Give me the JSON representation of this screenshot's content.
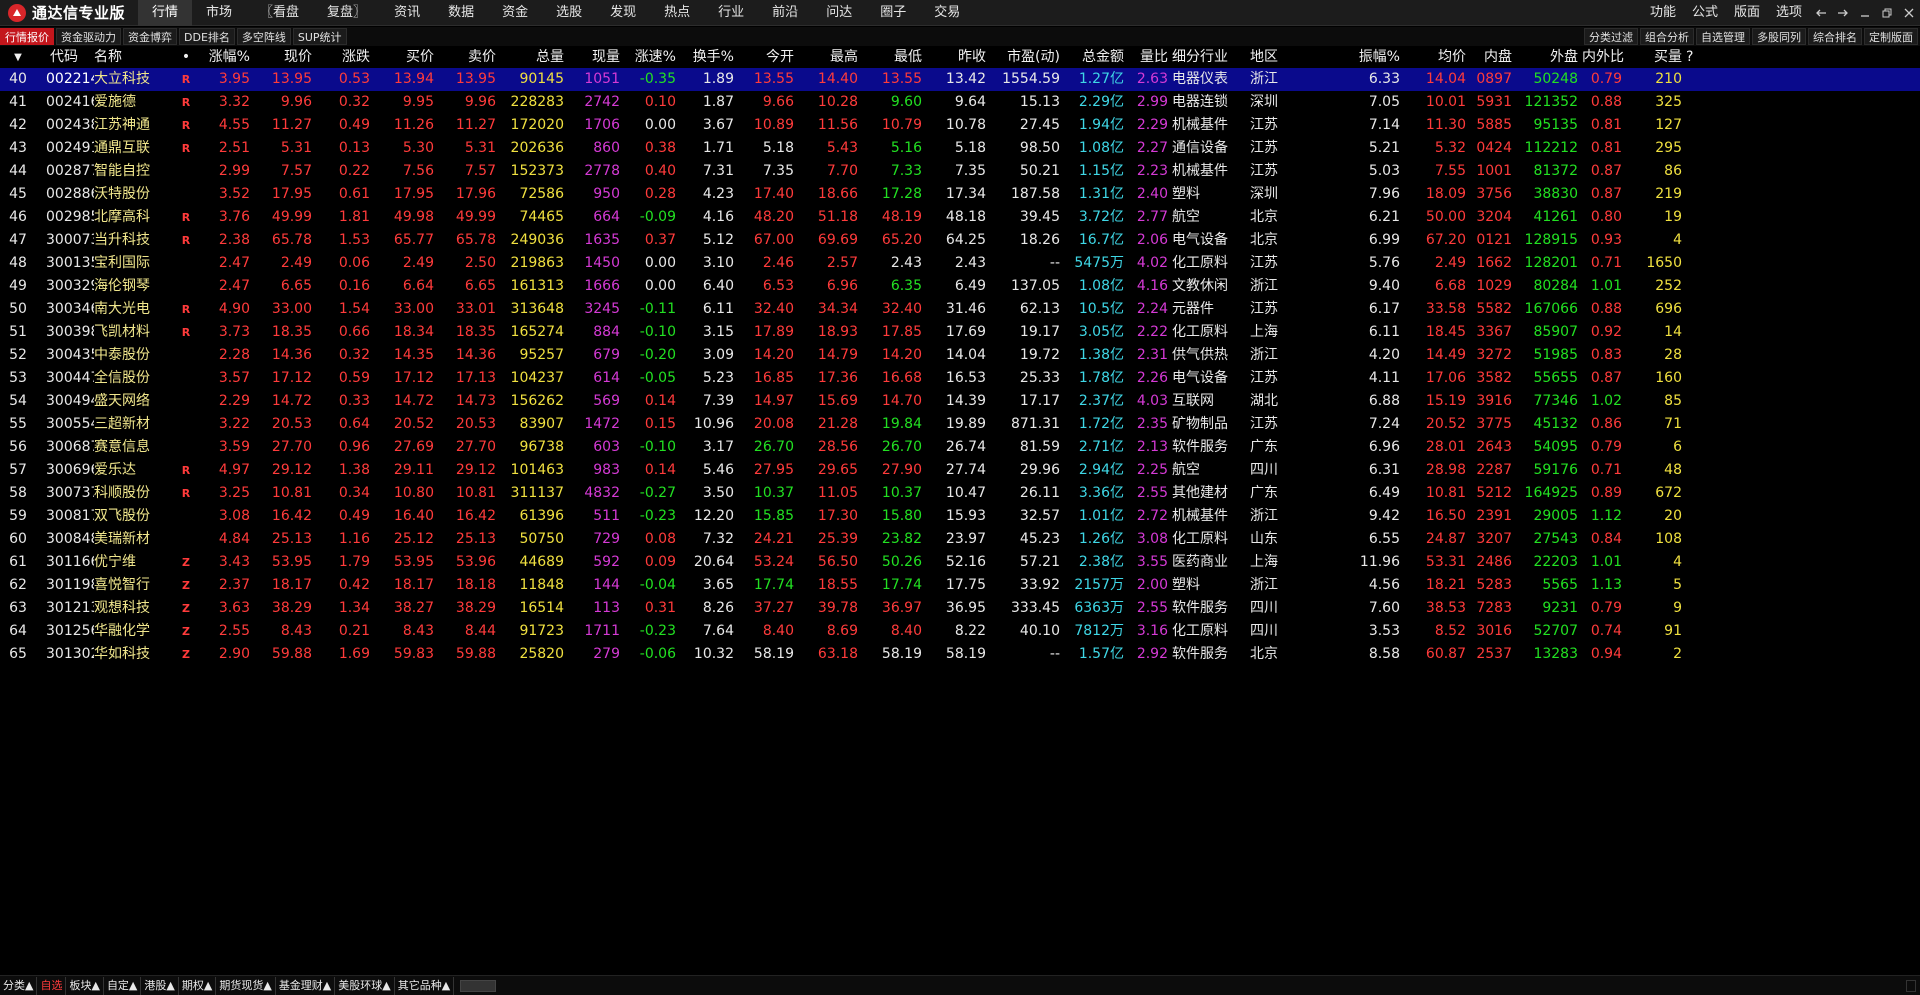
{
  "app": {
    "title": "通达信专业版"
  },
  "top_menu": [
    "行情",
    "市场",
    "〖看盘",
    "复盘〗",
    "资讯",
    "数据",
    "资金",
    "选股",
    "发现",
    "热点",
    "行业",
    "前沿",
    "问达",
    "圈子",
    "交易"
  ],
  "top_right_menu": [
    "功能",
    "公式",
    "版面",
    "选项"
  ],
  "sub_tabs": [
    "行情报价",
    "资金驱动力",
    "资金博弈",
    "DDE排名",
    "多空阵线",
    "SUP统计"
  ],
  "sub_tabs_right": [
    "分类过滤",
    "组合分析",
    "自选管理",
    "多股同列",
    "综合排名",
    "定制版面"
  ],
  "columns": [
    "代码",
    "名称",
    "•",
    "涨幅%",
    "现价",
    "涨跌",
    "买价",
    "卖价",
    "总量",
    "现量",
    "涨速%",
    "换手%",
    "今开",
    "最高",
    "最低",
    "昨收",
    "市盈(动)",
    "总金额",
    "量比",
    "细分行业",
    "地区",
    "振幅%",
    "均价",
    "内盘",
    "外盘",
    "内外比",
    "买量",
    "?"
  ],
  "rows": [
    [
      "40",
      "002214",
      "大立科技",
      "R",
      "3.95",
      "13.95",
      "0.53",
      "13.94",
      "13.95",
      "90145",
      "1051",
      "-0.35",
      "1.89",
      "13.55",
      "14.40",
      "13.55",
      "13.42",
      "1554.59",
      "1.27亿",
      "2.63",
      "电器仪表",
      "浙江",
      "6.33",
      "14.04",
      "0897",
      "50248",
      "0.79",
      "210"
    ],
    [
      "41",
      "002416",
      "爱施德",
      "R",
      "3.32",
      "9.96",
      "0.32",
      "9.95",
      "9.96",
      "228283",
      "2742",
      "0.10",
      "1.87",
      "9.66",
      "10.28",
      "9.60",
      "9.64",
      "15.13",
      "2.29亿",
      "2.99",
      "电器连锁",
      "深圳",
      "7.05",
      "10.01",
      "5931",
      "121352",
      "0.88",
      "325"
    ],
    [
      "42",
      "002438",
      "江苏神通",
      "R",
      "4.55",
      "11.27",
      "0.49",
      "11.26",
      "11.27",
      "172020",
      "1706",
      "0.00",
      "3.67",
      "10.89",
      "11.56",
      "10.79",
      "10.78",
      "27.45",
      "1.94亿",
      "2.29",
      "机械基件",
      "江苏",
      "7.14",
      "11.30",
      "5885",
      "95135",
      "0.81",
      "127"
    ],
    [
      "43",
      "002491",
      "通鼎互联",
      "R",
      "2.51",
      "5.31",
      "0.13",
      "5.30",
      "5.31",
      "202636",
      "860",
      "0.38",
      "1.71",
      "5.18",
      "5.43",
      "5.16",
      "5.18",
      "98.50",
      "1.08亿",
      "2.27",
      "通信设备",
      "江苏",
      "5.21",
      "5.32",
      "0424",
      "112212",
      "0.81",
      "295"
    ],
    [
      "44",
      "002877",
      "智能自控",
      "",
      "2.99",
      "7.57",
      "0.22",
      "7.56",
      "7.57",
      "152373",
      "2778",
      "0.40",
      "7.31",
      "7.35",
      "7.70",
      "7.33",
      "7.35",
      "50.21",
      "1.15亿",
      "2.23",
      "机械基件",
      "江苏",
      "5.03",
      "7.55",
      "1001",
      "81372",
      "0.87",
      "86"
    ],
    [
      "45",
      "002886",
      "沃特股份",
      "",
      "3.52",
      "17.95",
      "0.61",
      "17.95",
      "17.96",
      "72586",
      "950",
      "0.28",
      "4.23",
      "17.40",
      "18.66",
      "17.28",
      "17.34",
      "187.58",
      "1.31亿",
      "2.40",
      "塑料",
      "深圳",
      "7.96",
      "18.09",
      "3756",
      "38830",
      "0.87",
      "219"
    ],
    [
      "46",
      "002985",
      "北摩高科",
      "R",
      "3.76",
      "49.99",
      "1.81",
      "49.98",
      "49.99",
      "74465",
      "664",
      "-0.09",
      "4.16",
      "48.20",
      "51.18",
      "48.19",
      "48.18",
      "39.45",
      "3.72亿",
      "2.77",
      "航空",
      "北京",
      "6.21",
      "50.00",
      "3204",
      "41261",
      "0.80",
      "19"
    ],
    [
      "47",
      "300073",
      "当升科技",
      "R",
      "2.38",
      "65.78",
      "1.53",
      "65.77",
      "65.78",
      "249036",
      "1635",
      "0.37",
      "5.12",
      "67.00",
      "69.69",
      "65.20",
      "64.25",
      "18.26",
      "16.7亿",
      "2.06",
      "电气设备",
      "北京",
      "6.99",
      "67.20",
      "0121",
      "128915",
      "0.93",
      "4"
    ],
    [
      "48",
      "300135",
      "宝利国际",
      "",
      "2.47",
      "2.49",
      "0.06",
      "2.49",
      "2.50",
      "219863",
      "1450",
      "0.00",
      "3.10",
      "2.46",
      "2.57",
      "2.43",
      "2.43",
      "--",
      "5475万",
      "4.02",
      "化工原料",
      "江苏",
      "5.76",
      "2.49",
      "1662",
      "128201",
      "0.71",
      "1650"
    ],
    [
      "49",
      "300329",
      "海伦钢琴",
      "",
      "2.47",
      "6.65",
      "0.16",
      "6.64",
      "6.65",
      "161313",
      "1666",
      "0.00",
      "6.40",
      "6.53",
      "6.96",
      "6.35",
      "6.49",
      "137.05",
      "1.08亿",
      "4.16",
      "文教休闲",
      "浙江",
      "9.40",
      "6.68",
      "1029",
      "80284",
      "1.01",
      "252"
    ],
    [
      "50",
      "300346",
      "南大光电",
      "R",
      "4.90",
      "33.00",
      "1.54",
      "33.00",
      "33.01",
      "313648",
      "3245",
      "-0.11",
      "6.11",
      "32.40",
      "34.34",
      "32.40",
      "31.46",
      "62.13",
      "10.5亿",
      "2.24",
      "元器件",
      "江苏",
      "6.17",
      "33.58",
      "5582",
      "167066",
      "0.88",
      "696"
    ],
    [
      "51",
      "300398",
      "飞凯材料",
      "R",
      "3.73",
      "18.35",
      "0.66",
      "18.34",
      "18.35",
      "165274",
      "884",
      "-0.10",
      "3.15",
      "17.89",
      "18.93",
      "17.85",
      "17.69",
      "19.17",
      "3.05亿",
      "2.22",
      "化工原料",
      "上海",
      "6.11",
      "18.45",
      "3367",
      "85907",
      "0.92",
      "14"
    ],
    [
      "52",
      "300435",
      "中泰股份",
      "",
      "2.28",
      "14.36",
      "0.32",
      "14.35",
      "14.36",
      "95257",
      "679",
      "-0.20",
      "3.09",
      "14.20",
      "14.79",
      "14.20",
      "14.04",
      "19.72",
      "1.38亿",
      "2.31",
      "供气供热",
      "浙江",
      "4.20",
      "14.49",
      "3272",
      "51985",
      "0.83",
      "28"
    ],
    [
      "53",
      "300447",
      "全信股份",
      "",
      "3.57",
      "17.12",
      "0.59",
      "17.12",
      "17.13",
      "104237",
      "614",
      "-0.05",
      "5.23",
      "16.85",
      "17.36",
      "16.68",
      "16.53",
      "25.33",
      "1.78亿",
      "2.26",
      "电气设备",
      "江苏",
      "4.11",
      "17.06",
      "3582",
      "55655",
      "0.87",
      "160"
    ],
    [
      "54",
      "300494",
      "盛天网络",
      "",
      "2.29",
      "14.72",
      "0.33",
      "14.72",
      "14.73",
      "156262",
      "569",
      "0.14",
      "7.39",
      "14.97",
      "15.69",
      "14.70",
      "14.39",
      "17.17",
      "2.37亿",
      "4.03",
      "互联网",
      "湖北",
      "6.88",
      "15.19",
      "3916",
      "77346",
      "1.02",
      "85"
    ],
    [
      "55",
      "300554",
      "三超新材",
      "",
      "3.22",
      "20.53",
      "0.64",
      "20.52",
      "20.53",
      "83907",
      "1472",
      "0.15",
      "10.96",
      "20.08",
      "21.28",
      "19.84",
      "19.89",
      "871.31",
      "1.72亿",
      "2.35",
      "矿物制品",
      "江苏",
      "7.24",
      "20.52",
      "3775",
      "45132",
      "0.86",
      "71"
    ],
    [
      "56",
      "300687",
      "赛意信息",
      "",
      "3.59",
      "27.70",
      "0.96",
      "27.69",
      "27.70",
      "96738",
      "603",
      "-0.10",
      "3.17",
      "26.70",
      "28.56",
      "26.70",
      "26.74",
      "81.59",
      "2.71亿",
      "2.13",
      "软件服务",
      "广东",
      "6.96",
      "28.01",
      "2643",
      "54095",
      "0.79",
      "6"
    ],
    [
      "57",
      "300696",
      "爱乐达",
      "R",
      "4.97",
      "29.12",
      "1.38",
      "29.11",
      "29.12",
      "101463",
      "983",
      "0.14",
      "5.46",
      "27.95",
      "29.65",
      "27.90",
      "27.74",
      "29.96",
      "2.94亿",
      "2.25",
      "航空",
      "四川",
      "6.31",
      "28.98",
      "2287",
      "59176",
      "0.71",
      "48"
    ],
    [
      "58",
      "300737",
      "科顺股份",
      "R",
      "3.25",
      "10.81",
      "0.34",
      "10.80",
      "10.81",
      "311137",
      "4832",
      "-0.27",
      "3.50",
      "10.37",
      "11.05",
      "10.37",
      "10.47",
      "26.11",
      "3.36亿",
      "2.55",
      "其他建材",
      "广东",
      "6.49",
      "10.81",
      "5212",
      "164925",
      "0.89",
      "672"
    ],
    [
      "59",
      "300817",
      "双飞股份",
      "",
      "3.08",
      "16.42",
      "0.49",
      "16.40",
      "16.42",
      "61396",
      "511",
      "-0.23",
      "12.20",
      "15.85",
      "17.30",
      "15.80",
      "15.93",
      "32.57",
      "1.01亿",
      "2.72",
      "机械基件",
      "浙江",
      "9.42",
      "16.50",
      "2391",
      "29005",
      "1.12",
      "20"
    ],
    [
      "60",
      "300848",
      "美瑞新材",
      "",
      "4.84",
      "25.13",
      "1.16",
      "25.12",
      "25.13",
      "50750",
      "729",
      "0.08",
      "7.32",
      "24.21",
      "25.39",
      "23.82",
      "23.97",
      "45.23",
      "1.26亿",
      "3.08",
      "化工原料",
      "山东",
      "6.55",
      "24.87",
      "3207",
      "27543",
      "0.84",
      "108"
    ],
    [
      "61",
      "301166",
      "优宁维",
      "Z",
      "3.43",
      "53.95",
      "1.79",
      "53.95",
      "53.96",
      "44689",
      "592",
      "0.09",
      "20.64",
      "53.24",
      "56.50",
      "50.26",
      "52.16",
      "57.21",
      "2.38亿",
      "3.55",
      "医药商业",
      "上海",
      "11.96",
      "53.31",
      "2486",
      "22203",
      "1.01",
      "4"
    ],
    [
      "62",
      "301198",
      "喜悦智行",
      "Z",
      "2.37",
      "18.17",
      "0.42",
      "18.17",
      "18.18",
      "11848",
      "144",
      "-0.04",
      "3.65",
      "17.74",
      "18.55",
      "17.74",
      "17.75",
      "33.92",
      "2157万",
      "2.00",
      "塑料",
      "浙江",
      "4.56",
      "18.21",
      "5283",
      "5565",
      "1.13",
      "5"
    ],
    [
      "63",
      "301213",
      "观想科技",
      "Z",
      "3.63",
      "38.29",
      "1.34",
      "38.27",
      "38.29",
      "16514",
      "113",
      "0.31",
      "8.26",
      "37.27",
      "39.78",
      "36.97",
      "36.95",
      "333.45",
      "6363万",
      "2.55",
      "软件服务",
      "四川",
      "7.60",
      "38.53",
      "7283",
      "9231",
      "0.79",
      "9"
    ],
    [
      "64",
      "301256",
      "华融化学",
      "Z",
      "2.55",
      "8.43",
      "0.21",
      "8.43",
      "8.44",
      "91723",
      "1711",
      "-0.23",
      "7.64",
      "8.40",
      "8.69",
      "8.40",
      "8.22",
      "40.10",
      "7812万",
      "3.16",
      "化工原料",
      "四川",
      "3.53",
      "8.52",
      "3016",
      "52707",
      "0.74",
      "91"
    ],
    [
      "65",
      "301302",
      "华如科技",
      "Z",
      "2.90",
      "59.88",
      "1.69",
      "59.83",
      "59.88",
      "25820",
      "279",
      "-0.06",
      "10.32",
      "58.19",
      "63.18",
      "58.19",
      "58.19",
      "--",
      "1.57亿",
      "2.92",
      "软件服务",
      "北京",
      "8.58",
      "60.87",
      "2537",
      "13283",
      "0.94",
      "2"
    ]
  ],
  "selected_row_index": 0,
  "bottom_tabs": [
    "分类▲",
    "自选",
    "板块▲",
    "自定▲",
    "港股▲",
    "期权▲",
    "期货现货▲",
    "基金理财▲",
    "美股环球▲",
    "其它品种▲"
  ],
  "colors": {
    "up": "#ff3b3b",
    "down": "#22e022",
    "volume": "#f0e040",
    "amount": "#3fd7e6",
    "ratio": "#d53ad5",
    "selected_row": "#0a0a8c",
    "active_tab": "#c3161c"
  }
}
